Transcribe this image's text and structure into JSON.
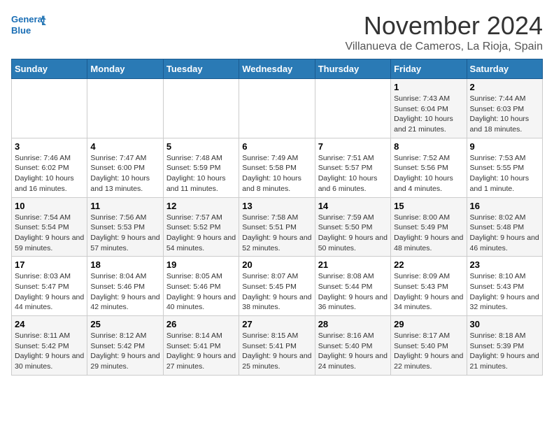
{
  "header": {
    "logo_line1": "General",
    "logo_line2": "Blue",
    "month": "November 2024",
    "location": "Villanueva de Cameros, La Rioja, Spain"
  },
  "days_of_week": [
    "Sunday",
    "Monday",
    "Tuesday",
    "Wednesday",
    "Thursday",
    "Friday",
    "Saturday"
  ],
  "weeks": [
    [
      {
        "day": "",
        "info": ""
      },
      {
        "day": "",
        "info": ""
      },
      {
        "day": "",
        "info": ""
      },
      {
        "day": "",
        "info": ""
      },
      {
        "day": "",
        "info": ""
      },
      {
        "day": "1",
        "info": "Sunrise: 7:43 AM\nSunset: 6:04 PM\nDaylight: 10 hours and 21 minutes."
      },
      {
        "day": "2",
        "info": "Sunrise: 7:44 AM\nSunset: 6:03 PM\nDaylight: 10 hours and 18 minutes."
      }
    ],
    [
      {
        "day": "3",
        "info": "Sunrise: 7:46 AM\nSunset: 6:02 PM\nDaylight: 10 hours and 16 minutes."
      },
      {
        "day": "4",
        "info": "Sunrise: 7:47 AM\nSunset: 6:00 PM\nDaylight: 10 hours and 13 minutes."
      },
      {
        "day": "5",
        "info": "Sunrise: 7:48 AM\nSunset: 5:59 PM\nDaylight: 10 hours and 11 minutes."
      },
      {
        "day": "6",
        "info": "Sunrise: 7:49 AM\nSunset: 5:58 PM\nDaylight: 10 hours and 8 minutes."
      },
      {
        "day": "7",
        "info": "Sunrise: 7:51 AM\nSunset: 5:57 PM\nDaylight: 10 hours and 6 minutes."
      },
      {
        "day": "8",
        "info": "Sunrise: 7:52 AM\nSunset: 5:56 PM\nDaylight: 10 hours and 4 minutes."
      },
      {
        "day": "9",
        "info": "Sunrise: 7:53 AM\nSunset: 5:55 PM\nDaylight: 10 hours and 1 minute."
      }
    ],
    [
      {
        "day": "10",
        "info": "Sunrise: 7:54 AM\nSunset: 5:54 PM\nDaylight: 9 hours and 59 minutes."
      },
      {
        "day": "11",
        "info": "Sunrise: 7:56 AM\nSunset: 5:53 PM\nDaylight: 9 hours and 57 minutes."
      },
      {
        "day": "12",
        "info": "Sunrise: 7:57 AM\nSunset: 5:52 PM\nDaylight: 9 hours and 54 minutes."
      },
      {
        "day": "13",
        "info": "Sunrise: 7:58 AM\nSunset: 5:51 PM\nDaylight: 9 hours and 52 minutes."
      },
      {
        "day": "14",
        "info": "Sunrise: 7:59 AM\nSunset: 5:50 PM\nDaylight: 9 hours and 50 minutes."
      },
      {
        "day": "15",
        "info": "Sunrise: 8:00 AM\nSunset: 5:49 PM\nDaylight: 9 hours and 48 minutes."
      },
      {
        "day": "16",
        "info": "Sunrise: 8:02 AM\nSunset: 5:48 PM\nDaylight: 9 hours and 46 minutes."
      }
    ],
    [
      {
        "day": "17",
        "info": "Sunrise: 8:03 AM\nSunset: 5:47 PM\nDaylight: 9 hours and 44 minutes."
      },
      {
        "day": "18",
        "info": "Sunrise: 8:04 AM\nSunset: 5:46 PM\nDaylight: 9 hours and 42 minutes."
      },
      {
        "day": "19",
        "info": "Sunrise: 8:05 AM\nSunset: 5:46 PM\nDaylight: 9 hours and 40 minutes."
      },
      {
        "day": "20",
        "info": "Sunrise: 8:07 AM\nSunset: 5:45 PM\nDaylight: 9 hours and 38 minutes."
      },
      {
        "day": "21",
        "info": "Sunrise: 8:08 AM\nSunset: 5:44 PM\nDaylight: 9 hours and 36 minutes."
      },
      {
        "day": "22",
        "info": "Sunrise: 8:09 AM\nSunset: 5:43 PM\nDaylight: 9 hours and 34 minutes."
      },
      {
        "day": "23",
        "info": "Sunrise: 8:10 AM\nSunset: 5:43 PM\nDaylight: 9 hours and 32 minutes."
      }
    ],
    [
      {
        "day": "24",
        "info": "Sunrise: 8:11 AM\nSunset: 5:42 PM\nDaylight: 9 hours and 30 minutes."
      },
      {
        "day": "25",
        "info": "Sunrise: 8:12 AM\nSunset: 5:42 PM\nDaylight: 9 hours and 29 minutes."
      },
      {
        "day": "26",
        "info": "Sunrise: 8:14 AM\nSunset: 5:41 PM\nDaylight: 9 hours and 27 minutes."
      },
      {
        "day": "27",
        "info": "Sunrise: 8:15 AM\nSunset: 5:41 PM\nDaylight: 9 hours and 25 minutes."
      },
      {
        "day": "28",
        "info": "Sunrise: 8:16 AM\nSunset: 5:40 PM\nDaylight: 9 hours and 24 minutes."
      },
      {
        "day": "29",
        "info": "Sunrise: 8:17 AM\nSunset: 5:40 PM\nDaylight: 9 hours and 22 minutes."
      },
      {
        "day": "30",
        "info": "Sunrise: 8:18 AM\nSunset: 5:39 PM\nDaylight: 9 hours and 21 minutes."
      }
    ]
  ]
}
